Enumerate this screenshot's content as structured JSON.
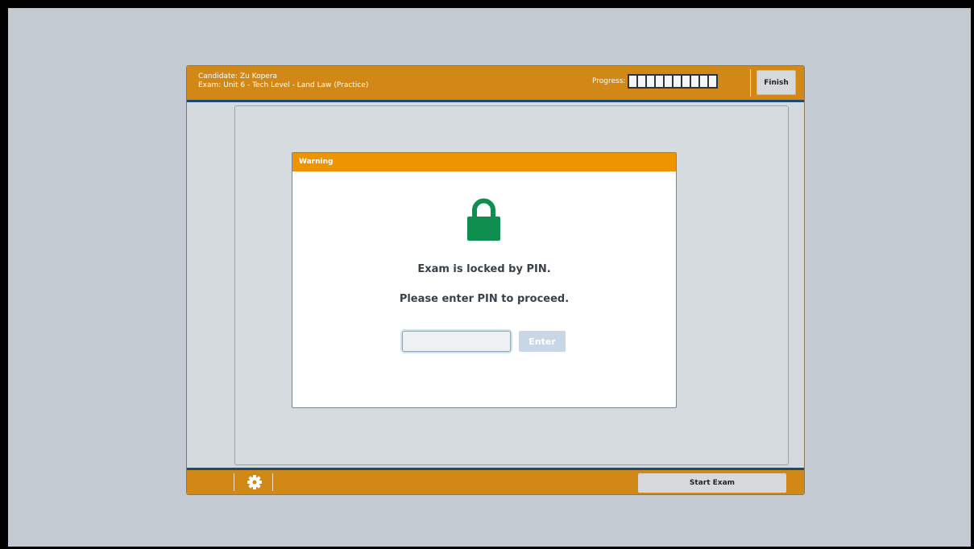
{
  "header": {
    "candidate": "Candidate: Zu Kopera",
    "exam": "Exam: Unit 6 - Tech Level - Land Law (Practice)",
    "progress_label": "Progress:",
    "progress_segments": 10,
    "progress_completed": 0,
    "finish_label": "Finish"
  },
  "dialog": {
    "title": "Warning",
    "icon": "lock-icon",
    "message1": "Exam is locked by PIN.",
    "message2": "Please enter PIN to proceed.",
    "pin_value": "",
    "enter_label": "Enter"
  },
  "footer": {
    "settings_icon": "gear-icon",
    "start_label": "Start Exam"
  },
  "colors": {
    "bar": "#d18817",
    "bar_border": "#1d4a73",
    "dialog_header": "#ee9400",
    "lock": "#0f8f4f"
  }
}
